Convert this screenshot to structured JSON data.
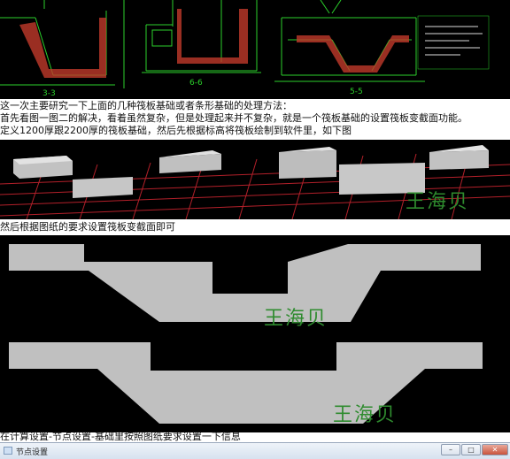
{
  "cad": {
    "label_3_3": "3-3",
    "label_6_6": "6-6",
    "label_5_5": "5-5"
  },
  "paragraph": {
    "line1": "这一次主要研究一下上面的几种筏板基础或者条形基础的处理方法：",
    "line2": "首先看图一图二的解决，看着虽然复杂，但是处理起来并不复杂，就是一个筏板基础的设置筏板变截面功能。",
    "line3": "定义1200厚跟2200厚的筏板基础，然后先根据标高将筏板绘制到软件里，如下图"
  },
  "iso_view": {
    "watermark": "王海贝"
  },
  "caption_sections": "然后根据图纸的要求设置筏板变截面即可",
  "section1": {
    "watermark": "王海贝"
  },
  "section2": {
    "watermark": "王海贝"
  },
  "caption_settings": "在计算设置-节点设置-基础里按照图纸要求设置一下信息",
  "window": {
    "title": "节点设置",
    "minimize_label": "–",
    "maximize_label": "□",
    "close_label": "✕"
  },
  "colors": {
    "cad_background": "#000000",
    "cad_line_green": "#2bd12b",
    "cad_hatch_red": "#c0392b",
    "slab_gray": "#b9b9b9",
    "grid_red": "#b3202a",
    "watermark_green": "#2e8b2e"
  }
}
